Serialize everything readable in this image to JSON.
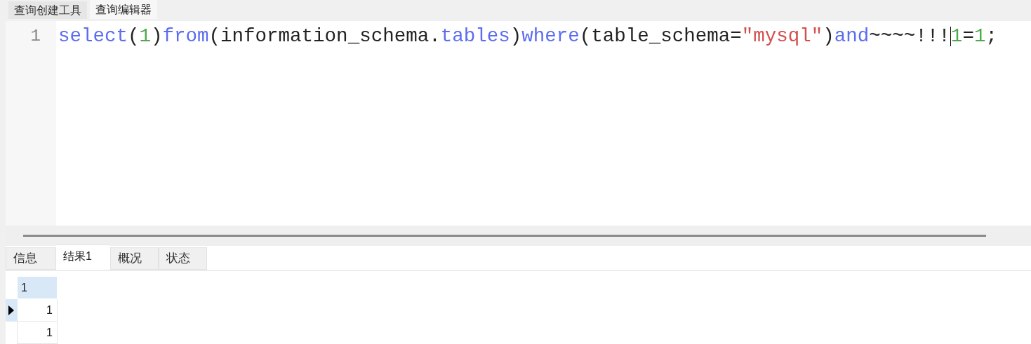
{
  "top_tabs": [
    {
      "label": "查询创建工具",
      "selected": false
    },
    {
      "label": "查询编辑器",
      "selected": true
    }
  ],
  "editor": {
    "lines": [
      {
        "number": "1",
        "tokens": [
          {
            "kind": "keyword",
            "text": "select"
          },
          {
            "kind": "plain",
            "text": "("
          },
          {
            "kind": "number",
            "text": "1"
          },
          {
            "kind": "plain",
            "text": ")"
          },
          {
            "kind": "keyword",
            "text": "from"
          },
          {
            "kind": "plain",
            "text": "(information_schema."
          },
          {
            "kind": "keyword",
            "text": "tables"
          },
          {
            "kind": "plain",
            "text": ")"
          },
          {
            "kind": "keyword",
            "text": "where"
          },
          {
            "kind": "plain",
            "text": "(table_schema="
          },
          {
            "kind": "string",
            "text": "\"mysql\""
          },
          {
            "kind": "plain",
            "text": ")"
          },
          {
            "kind": "keyword",
            "text": "and"
          },
          {
            "kind": "plain",
            "text": "~~~~!!!"
          },
          {
            "kind": "caret"
          },
          {
            "kind": "number",
            "text": "1"
          },
          {
            "kind": "plain",
            "text": "="
          },
          {
            "kind": "number",
            "text": "1"
          },
          {
            "kind": "plain",
            "text": ";"
          }
        ]
      }
    ]
  },
  "result_tabs": [
    {
      "label": "信息",
      "selected": false
    },
    {
      "label": "结果1",
      "selected": true
    },
    {
      "label": "概况",
      "selected": false
    },
    {
      "label": "状态",
      "selected": false
    }
  ],
  "grid": {
    "columns": [
      "1"
    ],
    "rows": [
      {
        "cells": [
          "1"
        ],
        "current": true
      },
      {
        "cells": [
          "1"
        ],
        "current": false
      }
    ]
  }
}
